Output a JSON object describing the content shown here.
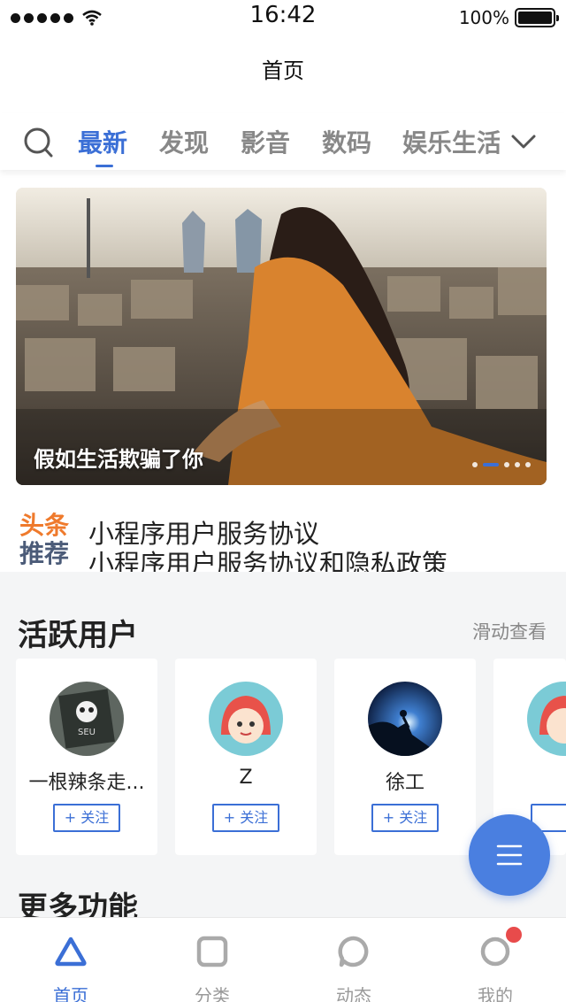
{
  "status_bar": {
    "time": "16:42",
    "battery": "100%"
  },
  "nav": {
    "title": "首页"
  },
  "tabs": {
    "items": [
      {
        "label": "最新",
        "active": true
      },
      {
        "label": "发现",
        "active": false
      },
      {
        "label": "影音",
        "active": false
      },
      {
        "label": "数码",
        "active": false
      },
      {
        "label": "娱乐生活",
        "active": false
      }
    ]
  },
  "banner": {
    "caption": "假如生活欺骗了你",
    "slide_count": 4,
    "active_slide": 1
  },
  "headline": {
    "badge_top": "头条",
    "badge_bottom": "推荐",
    "items": [
      "小程序用户服务协议",
      "小程序用户服务协议和隐私政策"
    ]
  },
  "active_users": {
    "title": "活跃用户",
    "more_label": "滑动查看",
    "follow_label": "+ 关注",
    "users": [
      {
        "name": "一根辣条走..."
      },
      {
        "name": "Z"
      },
      {
        "name": "徐工"
      }
    ]
  },
  "more_features": {
    "title": "更多功能"
  },
  "tabbar": {
    "items": [
      {
        "label": "首页",
        "icon": "triangle-icon",
        "active": true
      },
      {
        "label": "分类",
        "icon": "square-icon",
        "active": false
      },
      {
        "label": "动态",
        "icon": "bubble-icon",
        "active": false
      },
      {
        "label": "我的",
        "icon": "circle-icon",
        "active": false,
        "badge": true
      }
    ]
  },
  "colors": {
    "accent": "#3b6fd6",
    "badge_red": "#e84b4b",
    "headline_orange": "#ef7a2c"
  }
}
